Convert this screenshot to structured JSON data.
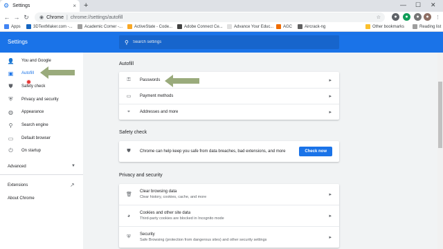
{
  "tab": {
    "title": "Settings",
    "close": "×",
    "new": "+"
  },
  "window": {
    "minimize": "—",
    "maximize": "☐",
    "close": "✕"
  },
  "toolbar": {
    "back": "←",
    "forward": "→",
    "reload": "↻",
    "url_scheme": "Chrome",
    "url_sep": "|",
    "url_path": "chrome://settings/autofill",
    "star": "☆"
  },
  "bookmarks": {
    "apps": "Apps",
    "items": [
      {
        "label": "3DTextMaker.com -...",
        "color": "#1565c0"
      },
      {
        "label": "Academic Corner -...",
        "color": "#9e9e9e"
      },
      {
        "label": "ActiveState - Code...",
        "color": "#f9a825"
      },
      {
        "label": "Adobe Connect Ce...",
        "color": "#424242"
      },
      {
        "label": "Advance Your Educ...",
        "color": "#e0e0e0"
      },
      {
        "label": "AGC",
        "color": "#ef6c00"
      },
      {
        "label": "Aircrack-ng",
        "color": "#616161"
      }
    ],
    "other": "Other bookmarks",
    "reading": "Reading list"
  },
  "header": {
    "title": "Settings",
    "search_placeholder": "Search settings"
  },
  "sidebar": {
    "items": [
      {
        "label": "You and Google"
      },
      {
        "label": "Autofill"
      },
      {
        "label": "Safety check"
      },
      {
        "label": "Privacy and security"
      },
      {
        "label": "Appearance"
      },
      {
        "label": "Search engine"
      },
      {
        "label": "Default browser"
      },
      {
        "label": "On startup"
      }
    ],
    "advanced": "Advanced",
    "extensions": "Extensions",
    "about": "About Chrome"
  },
  "autofill": {
    "title": "Autofill",
    "rows": [
      {
        "label": "Passwords"
      },
      {
        "label": "Payment methods"
      },
      {
        "label": "Addresses and more"
      }
    ]
  },
  "safety": {
    "title": "Safety check",
    "text": "Chrome can help keep you safe from data breaches, bad extensions, and more",
    "button": "Check now"
  },
  "privacy": {
    "title": "Privacy and security",
    "rows": [
      {
        "label": "Clear browsing data",
        "sub": "Clear history, cookies, cache, and more"
      },
      {
        "label": "Cookies and other site data",
        "sub": "Third-party cookies are blocked in Incognito mode"
      },
      {
        "label": "Security",
        "sub": "Safe Browsing (protection from dangerous sites) and other security settings"
      }
    ]
  },
  "colors": {
    "accent": "#1a73e8",
    "arrow": "#9aab7c"
  }
}
